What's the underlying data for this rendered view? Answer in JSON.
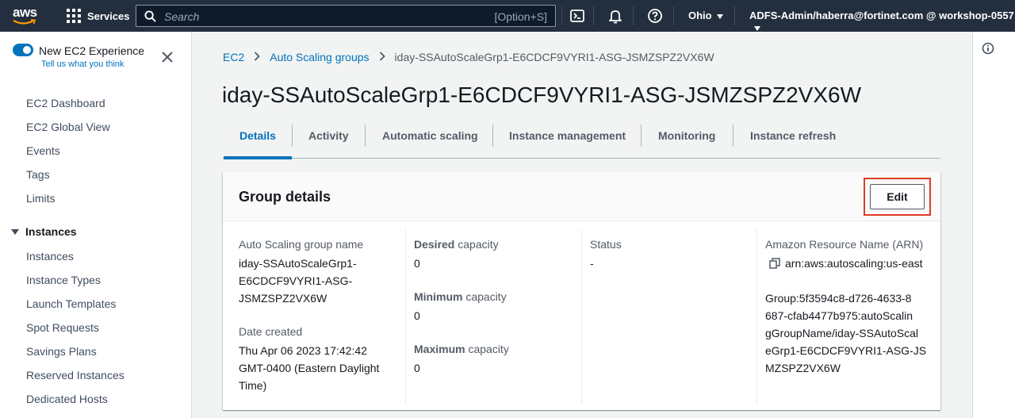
{
  "topnav": {
    "logo_text": "aws",
    "services_label": "Services",
    "search_placeholder": "Search",
    "search_shortcut": "[Option+S]",
    "region": "Ohio",
    "account": "ADFS-Admin/haberra@fortinet.com @ workshop-0557",
    "bg_color": "#232f3e"
  },
  "sidebar": {
    "new_experience_title": "New EC2 Experience",
    "new_experience_link": "Tell us what you think",
    "items": [
      {
        "label": "EC2 Dashboard"
      },
      {
        "label": "EC2 Global View"
      },
      {
        "label": "Events"
      },
      {
        "label": "Tags"
      },
      {
        "label": "Limits"
      }
    ],
    "section_instances": "Instances",
    "instance_items": [
      {
        "label": "Instances"
      },
      {
        "label": "Instance Types"
      },
      {
        "label": "Launch Templates"
      },
      {
        "label": "Spot Requests"
      },
      {
        "label": "Savings Plans"
      },
      {
        "label": "Reserved Instances"
      },
      {
        "label": "Dedicated Hosts"
      }
    ]
  },
  "breadcrumb": {
    "items": [
      "EC2",
      "Auto Scaling groups"
    ],
    "current": "iday-SSAutoScaleGrp1-E6CDCF9VYRI1-ASG-JSMZSPZ2VX6W"
  },
  "page_title": "iday-SSAutoScaleGrp1-E6CDCF9VYRI1-ASG-JSMZSPZ2VX6W",
  "tabs": [
    {
      "label": "Details",
      "active": true
    },
    {
      "label": "Activity"
    },
    {
      "label": "Automatic scaling"
    },
    {
      "label": "Instance management"
    },
    {
      "label": "Monitoring"
    },
    {
      "label": "Instance refresh"
    }
  ],
  "panel": {
    "title": "Group details",
    "edit_label": "Edit",
    "col1": {
      "name_label": "Auto Scaling group name",
      "name_lines": [
        "iday-SSAutoScaleGrp1-",
        "E6CDCF9VYRI1-ASG-",
        "JSMZSPZ2VX6W"
      ],
      "date_label": "Date created",
      "date_lines": [
        "Thu Apr 06 2023 17:42:42",
        "GMT-0400 (Eastern Daylight",
        "Time)"
      ]
    },
    "col2": {
      "desired_bold": "Desired",
      "desired_rest": " capacity",
      "desired_value": "0",
      "min_bold": "Minimum",
      "min_rest": " capacity",
      "min_value": "0",
      "max_bold": "Maximum",
      "max_rest": " capacity",
      "max_value": "0"
    },
    "col3": {
      "status_label": "Status",
      "status_value": "-"
    },
    "col4": {
      "arn_label": "Amazon Resource Name (ARN)",
      "arn_first": "arn:aws:autoscaling:us-east",
      "arn_lines": [
        "Group:5f3594c8-d726-4633-8",
        "687-cfab4477b975:autoScalin",
        "gGroupName/iday-SSAutoScal",
        "eGrp1-E6CDCF9VYRI1-ASG-JS",
        "MZSPZ2VX6W"
      ]
    }
  },
  "colors": {
    "link": "#0073bb",
    "highlight": "#e03a22"
  }
}
